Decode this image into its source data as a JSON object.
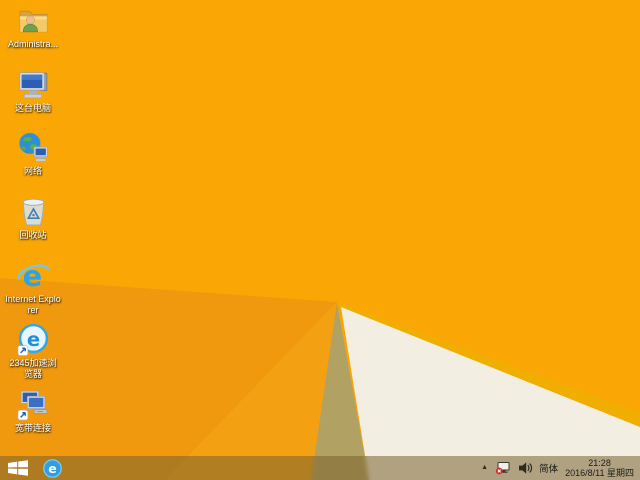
{
  "colors": {
    "wallpaper_base": "#FAA705",
    "wallpaper_facet_dark": "#F0990E",
    "wallpaper_facet_mid": "#F4A013",
    "wallpaper_fold_tan": "#B1A263",
    "wallpaper_edge_stripe": "#EFAE00",
    "wallpaper_fold_white": "#F2EEE2",
    "ie_blue": "#2E9FE0"
  },
  "desktop": {
    "icons": [
      {
        "name": "administrator-folder",
        "label": "Administra..."
      },
      {
        "name": "this-pc",
        "label": "这台电脑"
      },
      {
        "name": "network",
        "label": "网络"
      },
      {
        "name": "recycle-bin",
        "label": "回收站"
      },
      {
        "name": "internet-explorer",
        "label": "Internet Explorer"
      },
      {
        "name": "2345-browser",
        "label": "2345加速浏览器"
      },
      {
        "name": "broadband-connection",
        "label": "宽带连接"
      }
    ]
  },
  "taskbar": {
    "pinned": [
      {
        "name": "internet-explorer"
      }
    ],
    "tray": {
      "hidden_icons_glyph": "▲",
      "icons": [
        "network-disconnected",
        "volume"
      ],
      "ime_label": "简体",
      "time": "21:28",
      "date": "2016/8/11 星期四"
    }
  }
}
